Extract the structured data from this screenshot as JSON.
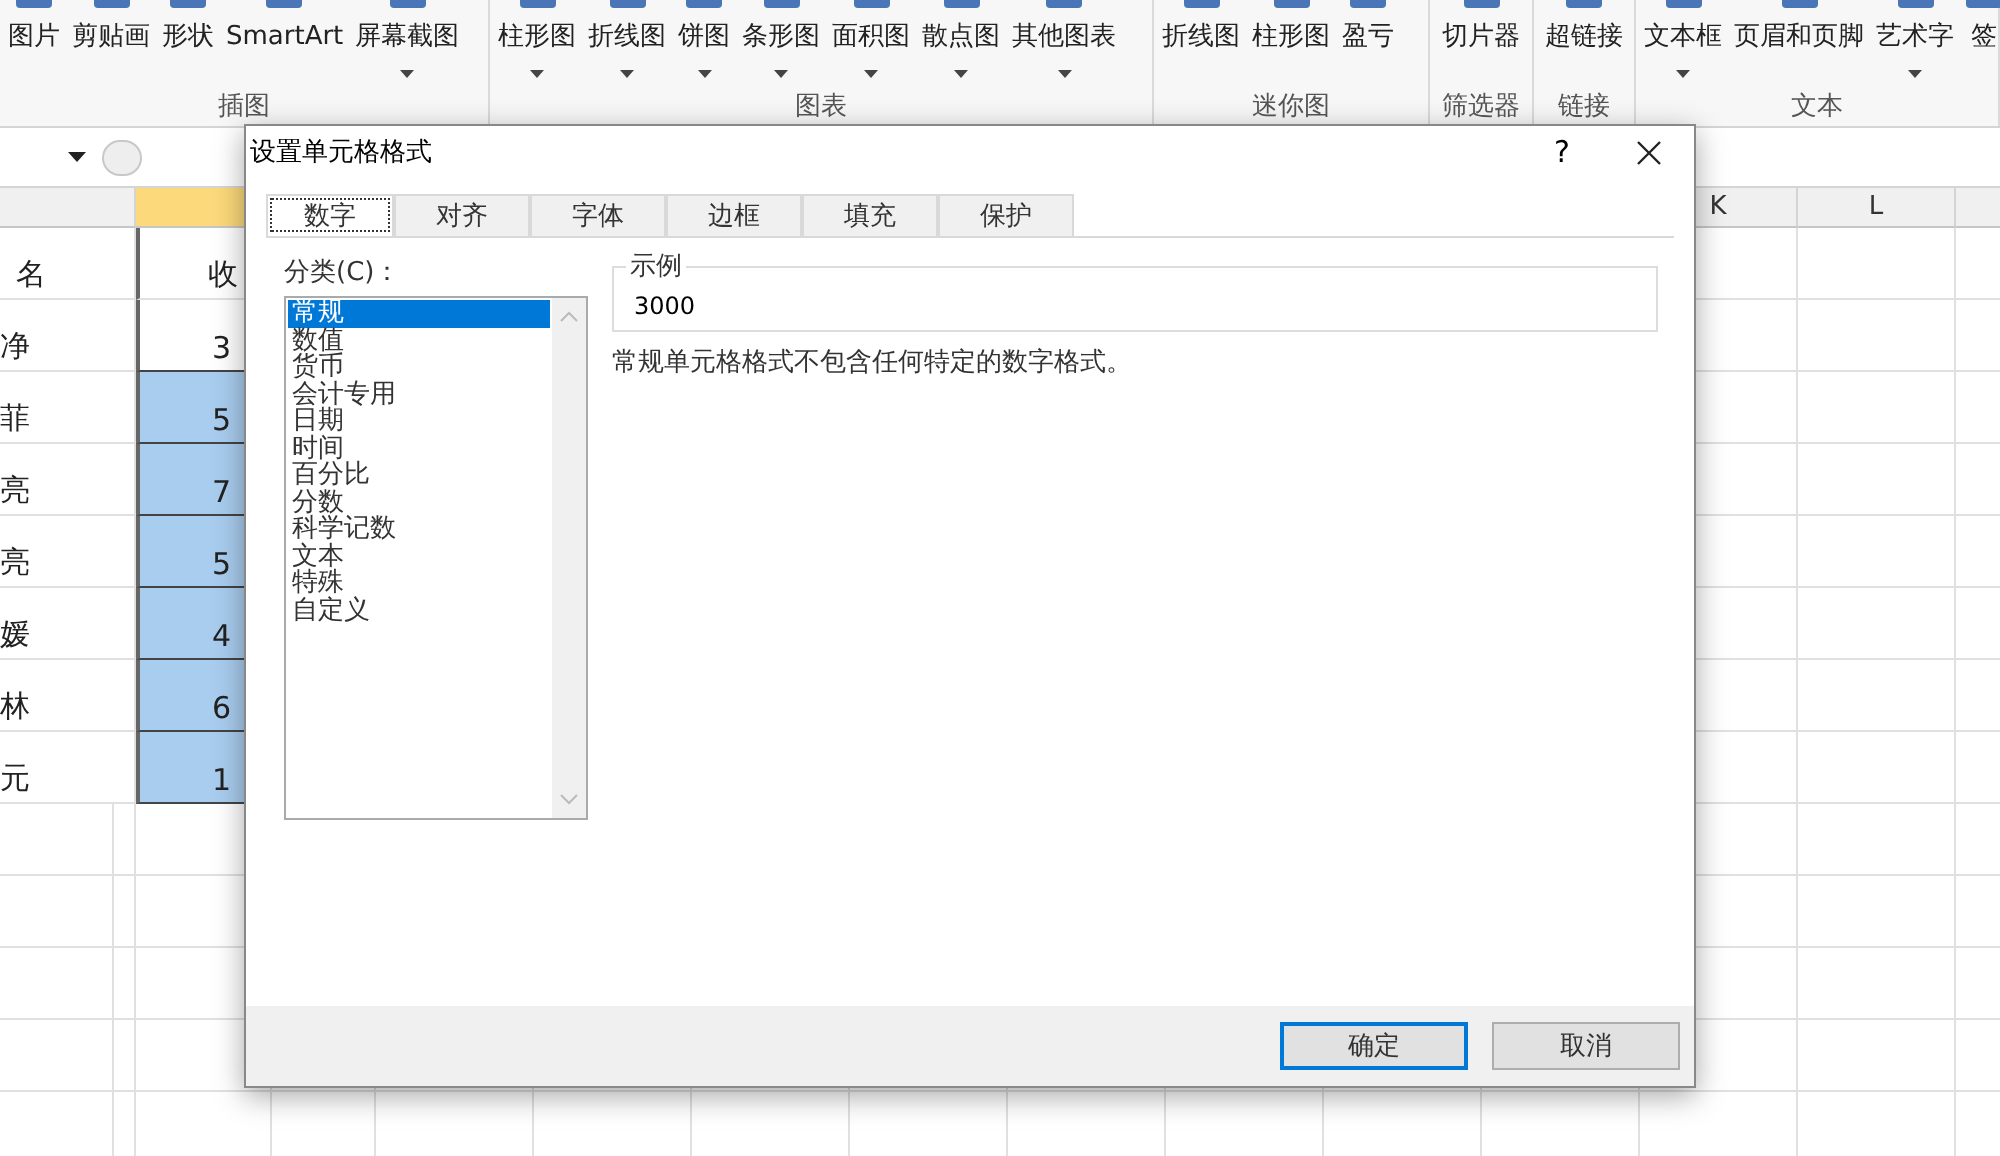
{
  "ribbon": {
    "groups": [
      {
        "label": "插图",
        "items": [
          {
            "label": "图片",
            "caret": false
          },
          {
            "label": "剪贴画",
            "caret": false
          },
          {
            "label": "形状",
            "caret": false
          },
          {
            "label": "SmartArt",
            "caret": false
          },
          {
            "label": "屏幕截图",
            "caret": true
          }
        ]
      },
      {
        "label": "图表",
        "items": [
          {
            "label": "柱形图",
            "caret": true
          },
          {
            "label": "折线图",
            "caret": true
          },
          {
            "label": "饼图",
            "caret": true
          },
          {
            "label": "条形图",
            "caret": true
          },
          {
            "label": "面积图",
            "caret": true
          },
          {
            "label": "散点图",
            "caret": true
          },
          {
            "label": "其他图表",
            "caret": true
          }
        ]
      },
      {
        "label": "迷你图",
        "items": [
          {
            "label": "折线图",
            "caret": false
          },
          {
            "label": "柱形图",
            "caret": false
          },
          {
            "label": "盈亏",
            "caret": false
          }
        ]
      },
      {
        "label": "筛选器",
        "items": [
          {
            "label": "切片器",
            "caret": false
          }
        ]
      },
      {
        "label": "链接",
        "items": [
          {
            "label": "超链接",
            "caret": false
          }
        ]
      },
      {
        "label": "文本",
        "items": [
          {
            "label": "文本框",
            "caret": true
          },
          {
            "label": "页眉和页脚",
            "caret": false
          },
          {
            "label": "艺术字",
            "caret": true
          },
          {
            "label": "签",
            "caret": false
          }
        ]
      }
    ]
  },
  "sheet": {
    "columns": [
      "K",
      "L"
    ],
    "header_row": {
      "name": "名",
      "income": "收"
    },
    "rows": [
      {
        "name": "净",
        "income": "3",
        "selected": false
      },
      {
        "name": "菲",
        "income": "5",
        "selected": true
      },
      {
        "name": "亮",
        "income": "7",
        "selected": true
      },
      {
        "name": "亮",
        "income": "5",
        "selected": true
      },
      {
        "name": "媛",
        "income": "4",
        "selected": true
      },
      {
        "name": "林",
        "income": "6",
        "selected": true
      },
      {
        "name": "元",
        "income": "1",
        "selected": true
      }
    ]
  },
  "dialog": {
    "title": "设置单元格格式",
    "help": "?",
    "tabs": [
      {
        "label": "数字",
        "selected": true
      },
      {
        "label": "对齐",
        "selected": false
      },
      {
        "label": "字体",
        "selected": false
      },
      {
        "label": "边框",
        "selected": false
      },
      {
        "label": "填充",
        "selected": false
      },
      {
        "label": "保护",
        "selected": false
      }
    ],
    "category_label": "分类(C)：",
    "categories": [
      {
        "label": "常规",
        "selected": true
      },
      {
        "label": "数值",
        "selected": false
      },
      {
        "label": "货币",
        "selected": false
      },
      {
        "label": "会计专用",
        "selected": false
      },
      {
        "label": "日期",
        "selected": false
      },
      {
        "label": "时间",
        "selected": false
      },
      {
        "label": "百分比",
        "selected": false
      },
      {
        "label": "分数",
        "selected": false
      },
      {
        "label": "科学记数",
        "selected": false
      },
      {
        "label": "文本",
        "selected": false
      },
      {
        "label": "特殊",
        "selected": false
      },
      {
        "label": "自定义",
        "selected": false
      }
    ],
    "sample": {
      "label": "示例",
      "value": "3000"
    },
    "description": "常规单元格格式不包含任何特定的数字格式。",
    "buttons": [
      {
        "label": "确定",
        "kind": "default"
      },
      {
        "label": "取消",
        "kind": "normal"
      }
    ]
  }
}
